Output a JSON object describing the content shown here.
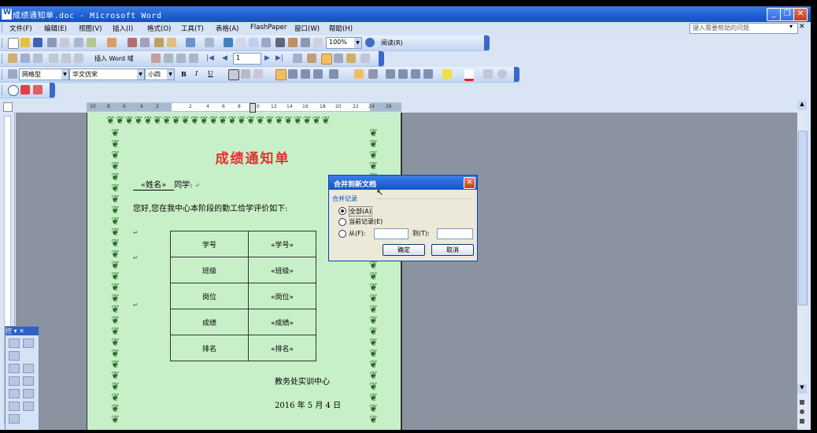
{
  "window": {
    "title": "成绩通知单.doc - Microsoft Word",
    "buttons": {
      "minimize": "_",
      "restore": "❐",
      "close": "✕"
    }
  },
  "menubar": {
    "items": [
      "文件(F)",
      "编辑(E)",
      "视图(V)",
      "插入(I)",
      "格式(O)",
      "工具(T)",
      "表格(A)",
      "FlashPaper",
      "窗口(W)",
      "帮助(H)"
    ],
    "help_placeholder": "键入需要帮助的问题"
  },
  "toolbar_standard": {
    "zoom": "100%",
    "read_label": "阅读(R)"
  },
  "toolbar_mailmerge": {
    "insert_word_field": "插入 Word 域",
    "record_number": "1"
  },
  "toolbar_formatting": {
    "style": "网格型",
    "font": "华文仿宋",
    "size": "小四",
    "bold": "B",
    "italic": "I",
    "underline": "U"
  },
  "ruler": {
    "numbers": [
      "10",
      "8",
      "6",
      "4",
      "2",
      "2",
      "4",
      "6",
      "8",
      "10",
      "12",
      "14",
      "16",
      "18",
      "20",
      "22",
      "24",
      "26"
    ]
  },
  "document": {
    "title": "成绩通知单",
    "name_field": "«姓名»",
    "greeting_suffix": "同学:",
    "intro": "您好,您在我中心本阶段的勤工俭学评价如下:",
    "table": [
      {
        "label": "学号",
        "field": "«学号»"
      },
      {
        "label": "班级",
        "field": "«班级»"
      },
      {
        "label": "岗位",
        "field": "«岗位»"
      },
      {
        "label": "成绩",
        "field": "«成绩»"
      },
      {
        "label": "排名",
        "field": "«排名»"
      }
    ],
    "signature": "教务处实训中心",
    "date": "2016 年 5 月 4 日"
  },
  "dialog": {
    "title": "合并到新文档",
    "group_label": "合并记录",
    "options": [
      "全部(A)",
      "当前记录(E)",
      "从(F):"
    ],
    "selected_option": "全部(A)",
    "to_label": "到(T):",
    "from_value": "",
    "to_value": "",
    "ok": "确定",
    "cancel": "取消"
  },
  "floating_panel": {
    "title": "控 ▾ ✕"
  },
  "colors": {
    "titlebar": "#1c5fd0",
    "page_background": "#c8f0c8",
    "doc_title": "#e03030",
    "vine": "#2c6a2c"
  }
}
